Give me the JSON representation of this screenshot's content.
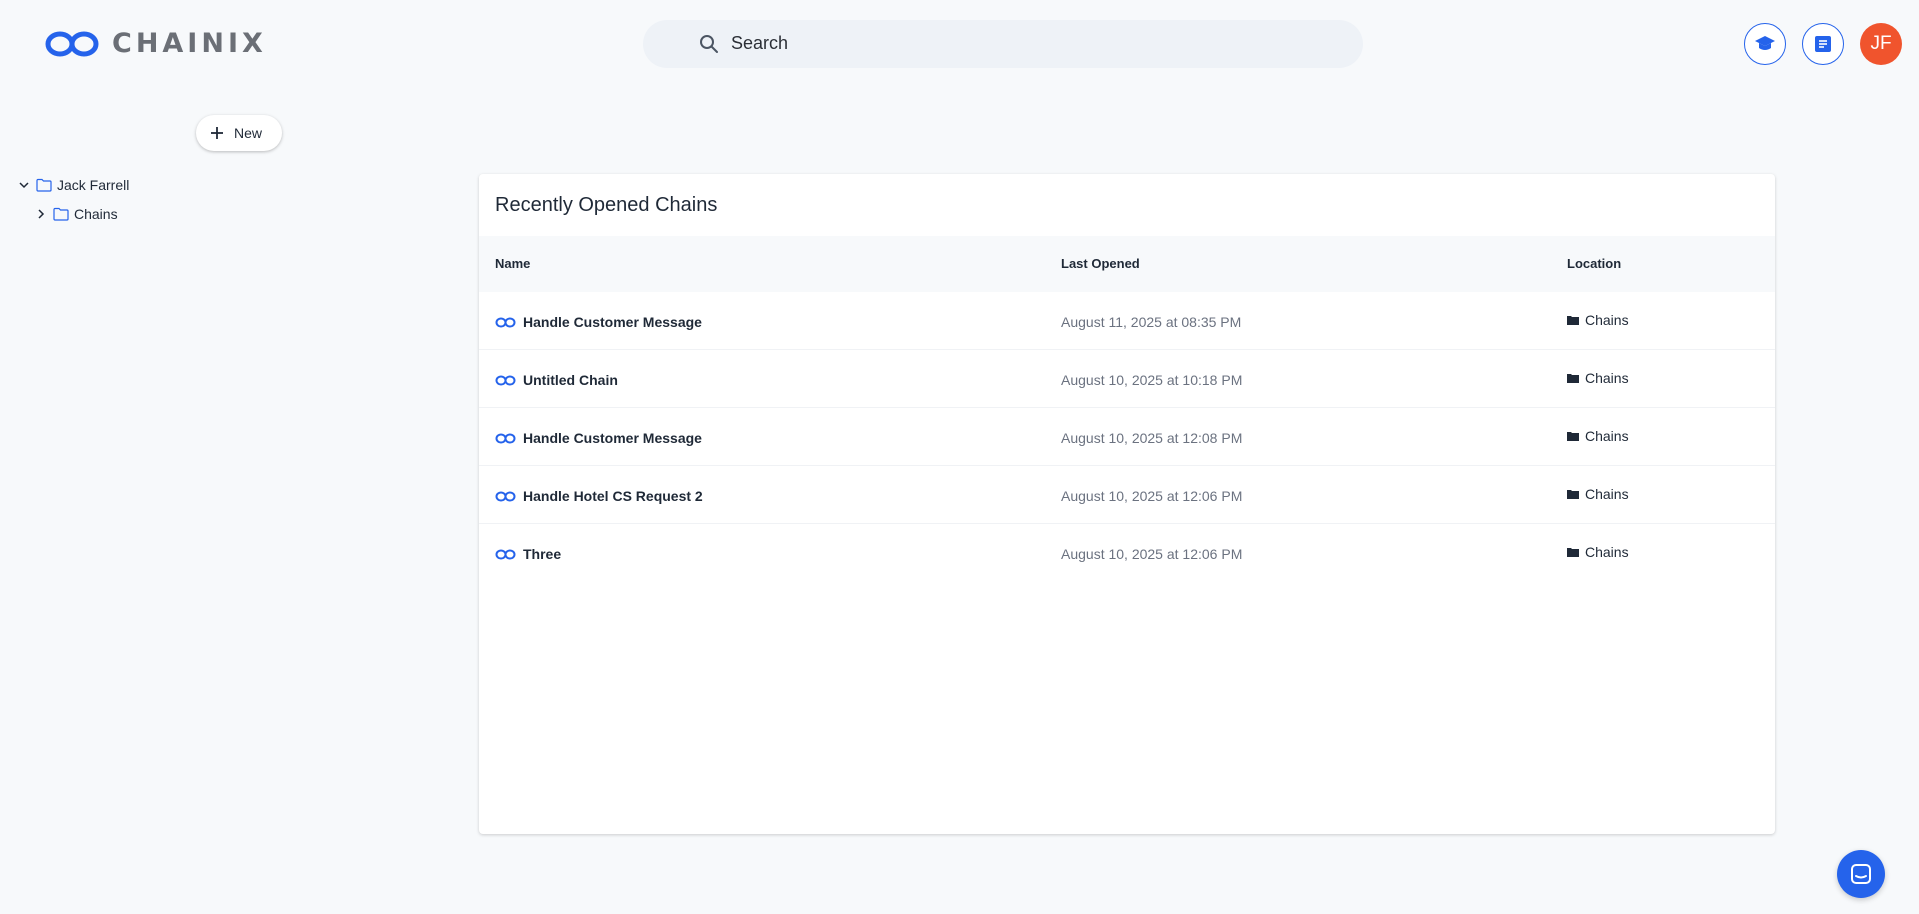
{
  "brand": {
    "name": "CHAINIX",
    "accent": "#2563eb"
  },
  "search": {
    "placeholder": "Search"
  },
  "header": {
    "learn_icon": "graduation-cap-icon",
    "docs_icon": "document-icon",
    "avatar_initials": "JF",
    "avatar_color": "#f0542d"
  },
  "sidebar": {
    "new_label": "New",
    "tree": {
      "root": "Jack Farrell",
      "children": [
        "Chains"
      ]
    }
  },
  "recent": {
    "title": "Recently Opened Chains",
    "columns": {
      "name": "Name",
      "last_opened": "Last Opened",
      "location": "Location"
    },
    "rows": [
      {
        "name": "Handle Customer Message",
        "opened": "August 11, 2025 at 08:35 PM",
        "location": "Chains"
      },
      {
        "name": "Untitled Chain",
        "opened": "August 10, 2025 at 10:18 PM",
        "location": "Chains"
      },
      {
        "name": "Handle Customer Message",
        "opened": "August 10, 2025 at 12:08 PM",
        "location": "Chains"
      },
      {
        "name": "Handle Hotel CS Request 2",
        "opened": "August 10, 2025 at 12:06 PM",
        "location": "Chains"
      },
      {
        "name": "Three",
        "opened": "August 10, 2025 at 12:06 PM",
        "location": "Chains"
      }
    ]
  },
  "chat": {
    "icon": "chat-icon"
  }
}
